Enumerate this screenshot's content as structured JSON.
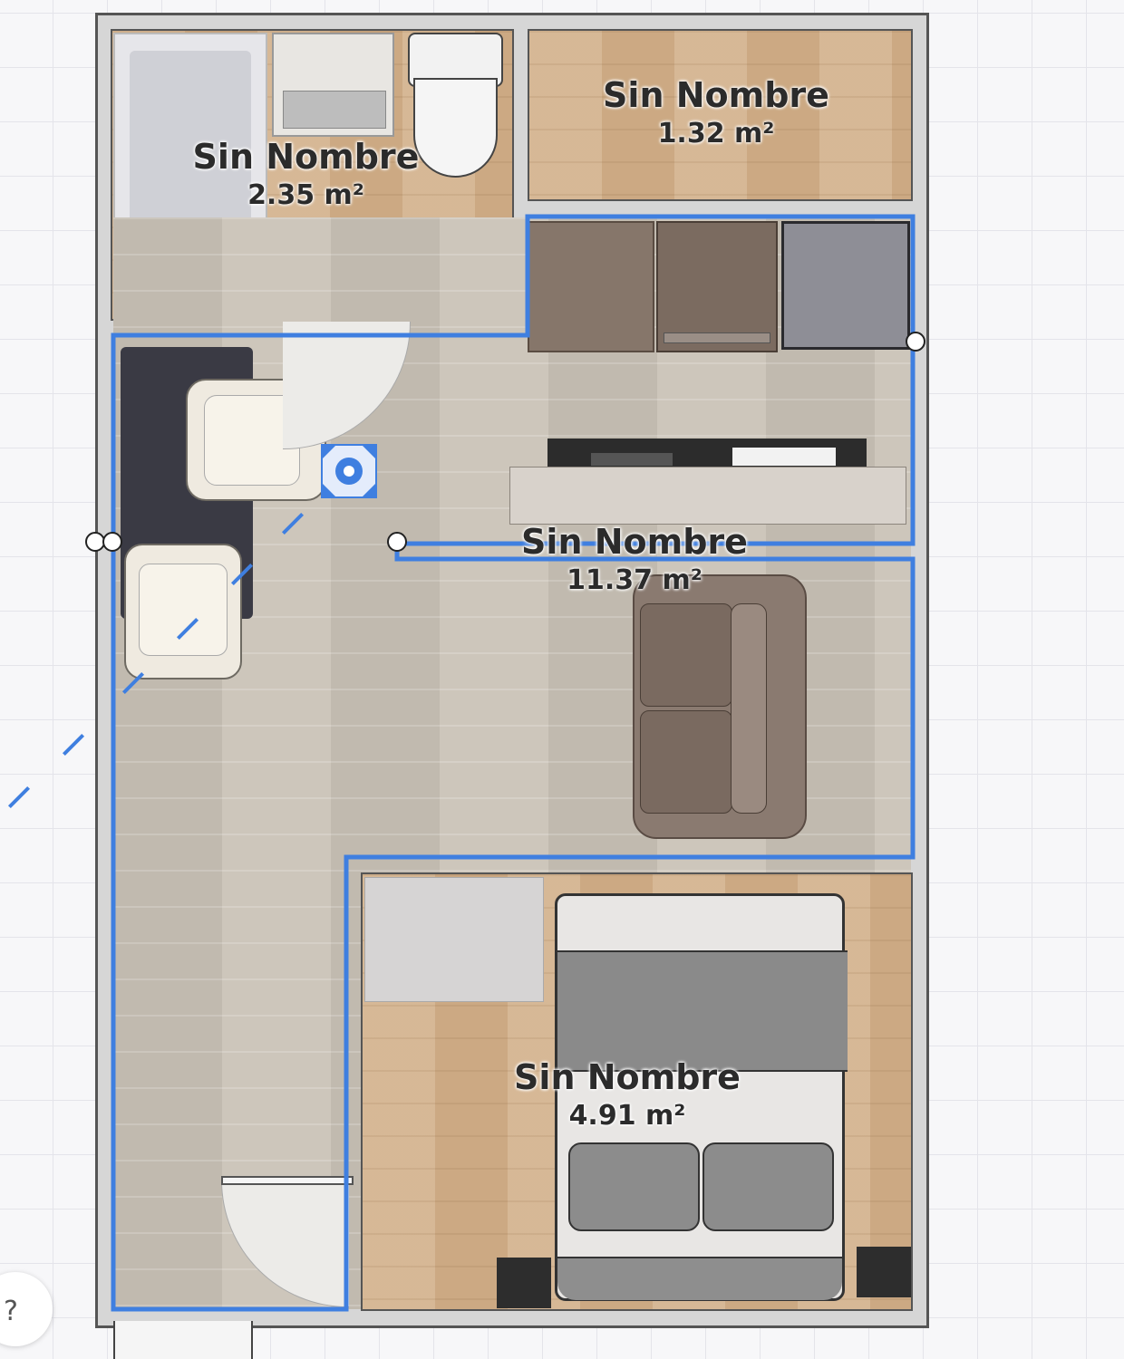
{
  "rooms": [
    {
      "name": "Sin Nombre",
      "area": "2.35 m²"
    },
    {
      "name": "Sin Nombre",
      "area": "1.32 m²"
    },
    {
      "name": "Sin Nombre",
      "area": "11.37 m²"
    },
    {
      "name": "Sin Nombre",
      "area": "4.91 m²"
    }
  ],
  "help": {
    "label": "?"
  },
  "colors": {
    "selection": "#3f7fe0",
    "wall": "#555555",
    "wood_floor": "#d2b08a",
    "light_floor": "#c9c2b6"
  },
  "icons": [
    "move-handle-icon",
    "help-icon"
  ]
}
